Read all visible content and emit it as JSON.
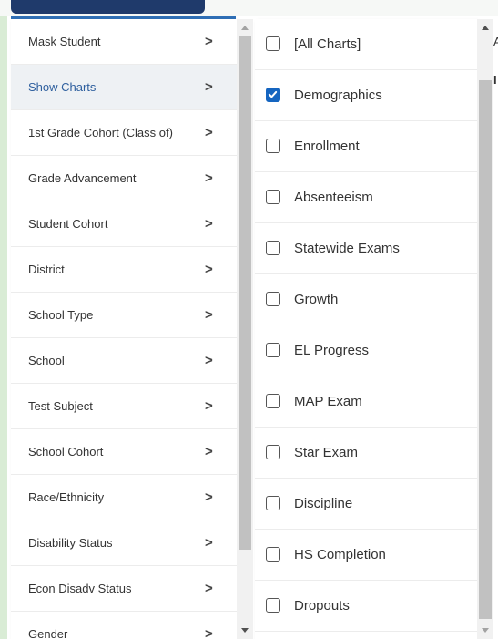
{
  "filter_menu": {
    "items": [
      {
        "label": "Mask Student",
        "active": false
      },
      {
        "label": "Show Charts",
        "active": true
      },
      {
        "label": "1st Grade Cohort (Class of)",
        "active": false
      },
      {
        "label": "Grade Advancement",
        "active": false
      },
      {
        "label": "Student Cohort",
        "active": false
      },
      {
        "label": "District",
        "active": false
      },
      {
        "label": "School Type",
        "active": false
      },
      {
        "label": "School",
        "active": false
      },
      {
        "label": "Test Subject",
        "active": false
      },
      {
        "label": "School Cohort",
        "active": false
      },
      {
        "label": "Race/Ethnicity",
        "active": false
      },
      {
        "label": "Disability Status",
        "active": false
      },
      {
        "label": "Econ Disadv Status",
        "active": false
      },
      {
        "label": "Gender",
        "active": false
      }
    ],
    "chevron_glyph": ">"
  },
  "show_charts": {
    "options": [
      {
        "label": "[All Charts]",
        "checked": false
      },
      {
        "label": "Demographics",
        "checked": true
      },
      {
        "label": "Enrollment",
        "checked": false
      },
      {
        "label": "Absenteeism",
        "checked": false
      },
      {
        "label": "Statewide Exams",
        "checked": false
      },
      {
        "label": "Growth",
        "checked": false
      },
      {
        "label": "EL Progress",
        "checked": false
      },
      {
        "label": "MAP Exam",
        "checked": false
      },
      {
        "label": "Star Exam",
        "checked": false
      },
      {
        "label": "Discipline",
        "checked": false
      },
      {
        "label": "HS Completion",
        "checked": false
      },
      {
        "label": "Dropouts",
        "checked": false
      }
    ]
  },
  "edge_text": {
    "top": "A",
    "second": "I"
  },
  "colors": {
    "accent": "#1565c0",
    "active_text": "#2e5f9e",
    "header_tab": "#1f3a6b"
  }
}
